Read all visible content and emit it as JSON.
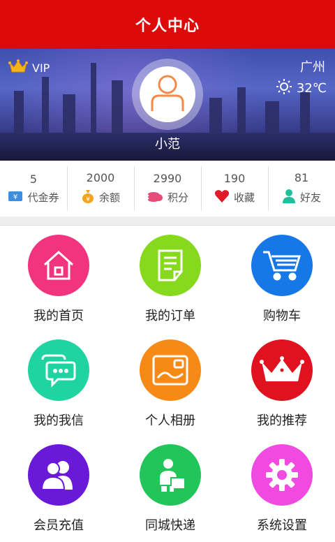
{
  "header": {
    "title": "个人中心"
  },
  "profile": {
    "vip_label": "VIP",
    "city": "广州",
    "temperature": "32℃",
    "nickname": "小范"
  },
  "stats": [
    {
      "value": "5",
      "label": "代金券",
      "icon": "voucher-icon",
      "color": "#3a8ee6"
    },
    {
      "value": "2000",
      "label": "余额",
      "icon": "money-bag-icon",
      "color": "#f3a51c"
    },
    {
      "value": "2990",
      "label": "积分",
      "icon": "coins-icon",
      "color": "#e84a7a"
    },
    {
      "value": "190",
      "label": "收藏",
      "icon": "heart-icon",
      "color": "#e01b2a"
    },
    {
      "value": "81",
      "label": "好友",
      "icon": "friend-icon",
      "color": "#1fbf9c"
    }
  ],
  "menu": [
    {
      "label": "我的首页",
      "icon": "home-icon",
      "color": "#f2347f"
    },
    {
      "label": "我的订单",
      "icon": "order-icon",
      "color": "#86d91c"
    },
    {
      "label": "购物车",
      "icon": "cart-icon",
      "color": "#1677e6"
    },
    {
      "label": "我的我信",
      "icon": "message-icon",
      "color": "#1fd4a0"
    },
    {
      "label": "个人相册",
      "icon": "album-icon",
      "color": "#f78a17"
    },
    {
      "label": "我的推荐",
      "icon": "crown-icon",
      "color": "#e0121f"
    },
    {
      "label": "会员充值",
      "icon": "members-icon",
      "color": "#6a19d9"
    },
    {
      "label": "同城快递",
      "icon": "courier-icon",
      "color": "#22c55a"
    },
    {
      "label": "系统设置",
      "icon": "gear-icon",
      "color": "#f04ae0"
    }
  ]
}
